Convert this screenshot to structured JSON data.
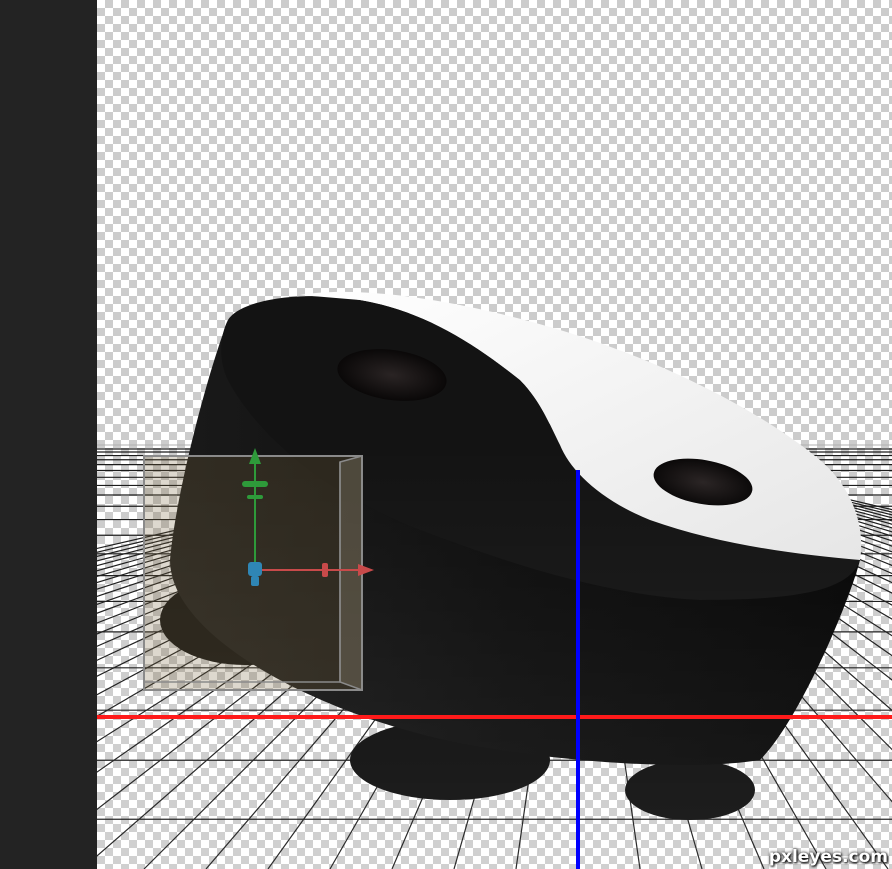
{
  "colors": {
    "panel": "#232323",
    "checker_light": "#ffffff",
    "checker_dark": "#cccccc",
    "object_black": "#121212",
    "object_white": "#f2f2f2",
    "x_axis": "#ff1a1a",
    "z_axis": "#0000ff",
    "gizmo_y": "#2e9a3a",
    "gizmo_x": "#c84a4a",
    "gizmo_center": "#2f86b5"
  },
  "icons": {
    "gizmo_y_arrow": "arrow-up-icon",
    "gizmo_x_arrow": "arrow-right-icon",
    "gizmo_center": "move-handle-icon"
  },
  "watermark": "pxleyes.com"
}
